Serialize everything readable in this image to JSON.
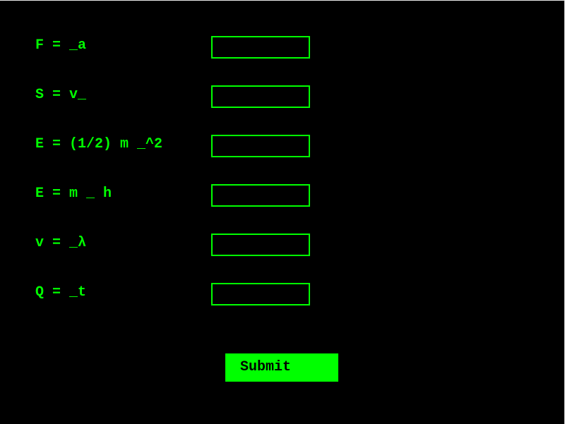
{
  "form": {
    "fields": [
      {
        "label": "F = _a",
        "value": ""
      },
      {
        "label": "S = v_",
        "value": ""
      },
      {
        "label": "E = (1/2) m _^2",
        "value": ""
      },
      {
        "label": "E = m _ h",
        "value": ""
      },
      {
        "label": "v = _λ",
        "value": ""
      },
      {
        "label": "Q = _t",
        "value": ""
      }
    ],
    "submit_label": "Submit"
  },
  "colors": {
    "background": "#000000",
    "accent": "#00ff00",
    "button_text": "#000000"
  }
}
